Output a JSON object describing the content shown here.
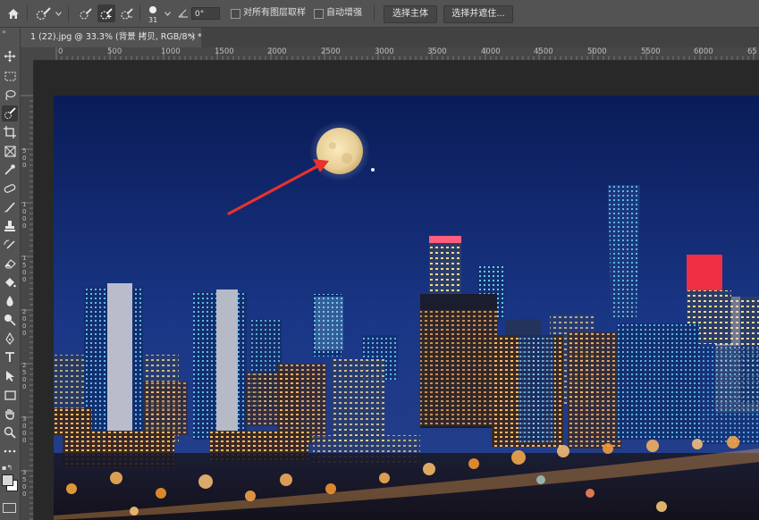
{
  "options_bar": {
    "home_icon": "home-icon",
    "brush_size": "31",
    "angle_value": "0°",
    "sample_all_layers_label": "对所有图层取样",
    "auto_enhance_label": "自动增强",
    "select_subject_label": "选择主体",
    "select_and_mask_label": "选择并遮住..."
  },
  "document": {
    "tab_title": "1 (22).jpg @ 33.3% (背景 拷贝, RGB/8*) *",
    "close_glyph": "×"
  },
  "ruler_h": {
    "labels": [
      "0",
      "500",
      "1000",
      "1500",
      "2000",
      "2500",
      "3000",
      "3500",
      "4000",
      "4500",
      "5000",
      "5500",
      "6000",
      "65"
    ]
  },
  "ruler_v": {
    "labels": [
      "5 0 0",
      "1 0 0 0",
      "1 5 0 0",
      "2 0 0 0",
      "2 5 0 0",
      "3 0 0 0",
      "3 5 0 0"
    ]
  },
  "tools": [
    "move-icon",
    "marquee-icon",
    "lasso-icon",
    "quick-selection-icon",
    "crop-icon",
    "frame-icon",
    "eyedropper-icon",
    "healing-brush-icon",
    "brush-icon",
    "clone-stamp-icon",
    "history-brush-icon",
    "eraser-icon",
    "paint-bucket-icon",
    "blur-icon",
    "dodge-icon",
    "pen-icon",
    "type-icon",
    "path-selection-icon",
    "rectangle-icon",
    "hand-icon",
    "zoom-icon",
    "more-icon"
  ],
  "colors": {
    "accent_arrow": "#e8322e",
    "sky_top": "#0b1e5a",
    "sky_bottom": "#1e3d8a"
  }
}
